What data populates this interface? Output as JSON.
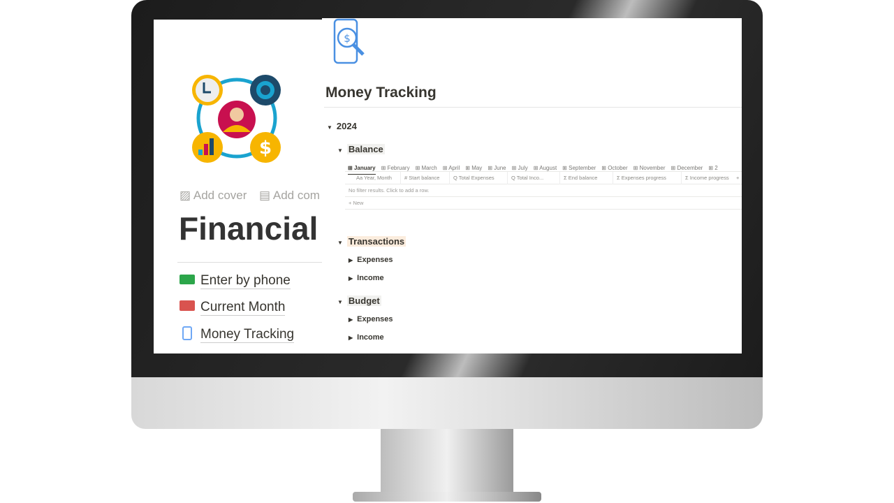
{
  "left_page": {
    "add_cover": "Add cover",
    "add_comment": "Add com",
    "title": "Financial",
    "links": [
      {
        "label": "Enter by phone",
        "icon": "money-hand-icon"
      },
      {
        "label": "Current Month",
        "icon": "wallet-icon"
      },
      {
        "label": "Money Tracking",
        "icon": "phone-dollar-icon"
      }
    ]
  },
  "page": {
    "title": "Money Tracking",
    "icon": "phone-dollar-search-icon",
    "year": "2024",
    "balance": "Balance",
    "tabs": [
      "January",
      "February",
      "March",
      "April",
      "May",
      "June",
      "July",
      "August",
      "September",
      "October",
      "November",
      "December",
      "2"
    ],
    "columns": [
      {
        "icon": "Aa",
        "label": "Year, Month"
      },
      {
        "icon": "#",
        "label": "Start balance"
      },
      {
        "icon": "Q",
        "label": "Total Expenses"
      },
      {
        "icon": "Q",
        "label": "Total Inco..."
      },
      {
        "icon": "Σ",
        "label": "End balance"
      },
      {
        "icon": "Σ",
        "label": "Expenses progress"
      },
      {
        "icon": "Σ",
        "label": "Income progress"
      }
    ],
    "add_column": "+",
    "empty": "No filter results. Click to add a row.",
    "new": "+ New",
    "transactions": "Transactions",
    "budget": "Budget",
    "expenses": "Expenses",
    "income": "Income"
  },
  "colors": {
    "highlight": "#fbecdd",
    "accent": "#4a90e2"
  }
}
